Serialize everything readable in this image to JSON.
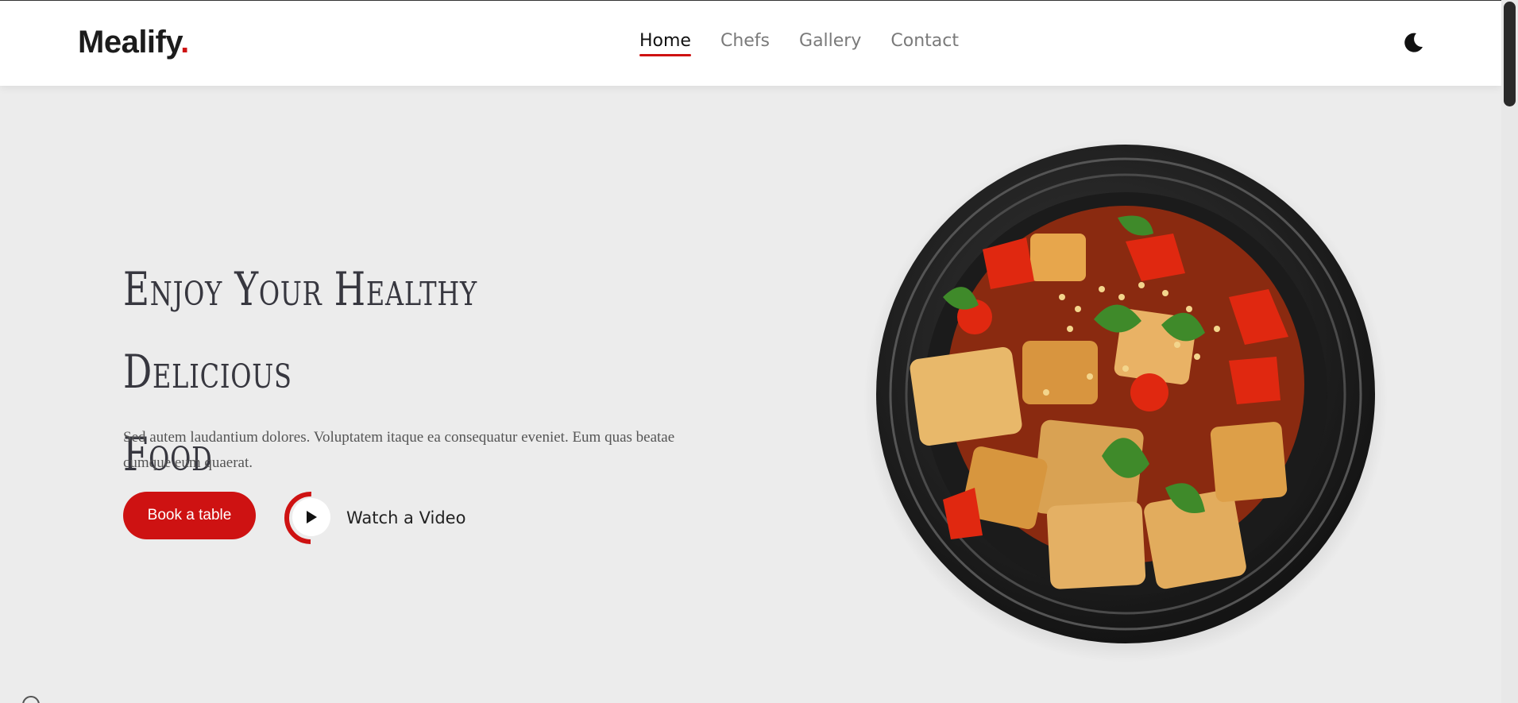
{
  "header": {
    "logo_text": "Mealify",
    "logo_dot": ".",
    "nav": [
      {
        "label": "Home",
        "active": true
      },
      {
        "label": "Chefs",
        "active": false
      },
      {
        "label": "Gallery",
        "active": false
      },
      {
        "label": "Contact",
        "active": false
      }
    ],
    "theme_toggle_icon": "moon-icon"
  },
  "hero": {
    "title_line1": "Enjoy Your Healthy Delicious",
    "title_line2": "Food",
    "description": "Sed autem laudantium dolores. Voluptatem itaque ea consequatur eveniet. Eum quas beatae cumque eum quaerat.",
    "book_button": "Book a table",
    "watch_label": "Watch a Video",
    "play_icon": "play-icon"
  },
  "dish_image": "food-plate-image",
  "colors": {
    "accent": "#ce1212",
    "background": "#ececec",
    "header_bg": "#ffffff",
    "text_dark": "#37373f"
  }
}
